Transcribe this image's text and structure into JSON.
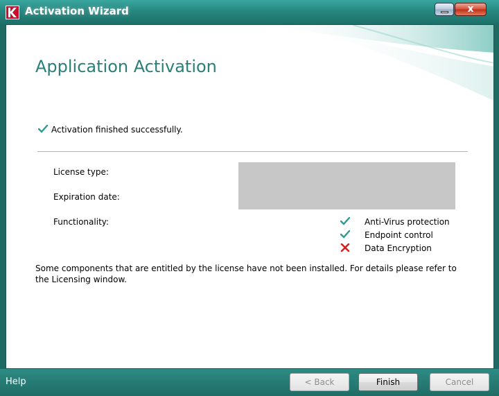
{
  "window": {
    "title": "Activation Wizard",
    "close_glyph": "x",
    "title_icon": "kaspersky-k-icon"
  },
  "page": {
    "title": "Application Activation",
    "status_text": "Activation finished successfully."
  },
  "license": {
    "type_label": "License type:",
    "expiration_label": "Expiration date:",
    "functionality_label": "Functionality:"
  },
  "functionality": [
    {
      "name": "Anti-Virus protection",
      "status": "installed",
      "icon": "green-check-icon"
    },
    {
      "name": "Endpoint control",
      "status": "installed",
      "icon": "green-check-icon"
    },
    {
      "name": "Data Encryption",
      "status": "not-installed",
      "icon": "red-x-icon"
    }
  ],
  "note": "Some components that are entitled by the license have not been installed. For details please refer to the Licensing window.",
  "footer": {
    "help": "Help",
    "back_label": "< Back",
    "finish_label": "Finish",
    "cancel_label": "Cancel"
  },
  "colors": {
    "accent": "#2a7f78",
    "titlebar": "#27877f",
    "footer": "#1f6c65",
    "check": "#2f9a8e",
    "error": "#d42020"
  }
}
